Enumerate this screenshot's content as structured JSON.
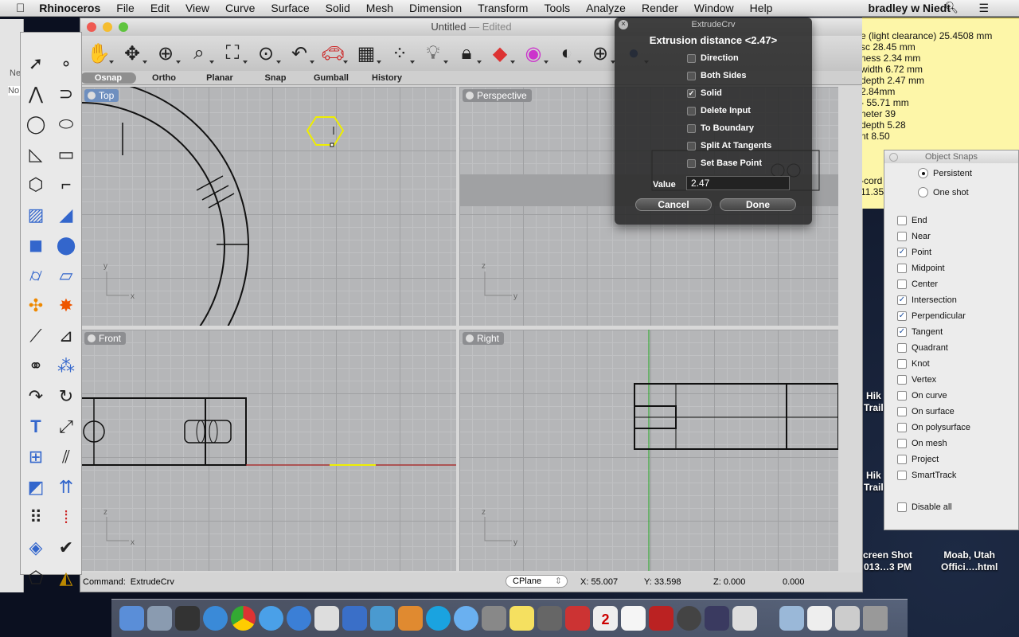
{
  "menubar": {
    "apple": "",
    "app": "Rhinoceros",
    "items": [
      "File",
      "Edit",
      "View",
      "Curve",
      "Surface",
      "Solid",
      "Mesh",
      "Dimension",
      "Transform",
      "Tools",
      "Analyze",
      "Render",
      "Window",
      "Help"
    ],
    "user": "bradley w Niedt"
  },
  "window": {
    "title": "Untitled",
    "edited": "— Edited"
  },
  "bgwin": {
    "label1": "Ne",
    "label2": "No"
  },
  "osnapbar": [
    "Osnap",
    "Ortho",
    "Planar",
    "Snap",
    "Gumball",
    "History"
  ],
  "viewports": {
    "top": "Top",
    "perspective": "Perspective",
    "front": "Front",
    "right": "Right"
  },
  "status": {
    "command_label": "Command:",
    "command": "ExtrudeCrv",
    "cplane": "CPlane",
    "x": "X: 55.007",
    "y": "Y: 33.598",
    "z": "Z: 0.000",
    "d": "0.000"
  },
  "hud": {
    "title": "ExtrudeCrv",
    "prompt": "Extrusion distance <2.47>",
    "options": [
      {
        "label": "Direction",
        "checked": false
      },
      {
        "label": "Both Sides",
        "checked": false
      },
      {
        "label": "Solid",
        "checked": true
      },
      {
        "label": "Delete Input",
        "checked": false
      },
      {
        "label": "To Boundary",
        "checked": false
      },
      {
        "label": "Split At Tangents",
        "checked": false
      },
      {
        "label": "Set Base Point",
        "checked": false
      }
    ],
    "value_label": "Value",
    "value": "2.47",
    "cancel": "Cancel",
    "done": "Done"
  },
  "sticky": [
    "e (light clearance) 25.4508 mm",
    "sc 28.45 mm",
    "ness 2.34 mm",
    "width 6.72 mm",
    "depth 2.47 mm",
    "2.84mm",
    "- 55.71 mm",
    "neter 39",
    "depth 5.28",
    "nt 8.50",
    "",
    "",
    "",
    "-cord",
    "11.35"
  ],
  "snaps": {
    "title": "Object Snaps",
    "persistent": "Persistent",
    "oneshot": "One shot",
    "mode": "Persistent",
    "items": [
      {
        "label": "End",
        "checked": false
      },
      {
        "label": "Near",
        "checked": false
      },
      {
        "label": "Point",
        "checked": true
      },
      {
        "label": "Midpoint",
        "checked": false
      },
      {
        "label": "Center",
        "checked": false
      },
      {
        "label": "Intersection",
        "checked": true
      },
      {
        "label": "Perpendicular",
        "checked": true
      },
      {
        "label": "Tangent",
        "checked": true
      },
      {
        "label": "Quadrant",
        "checked": false
      },
      {
        "label": "Knot",
        "checked": false
      },
      {
        "label": "Vertex",
        "checked": false
      },
      {
        "label": "On curve",
        "checked": false
      },
      {
        "label": "On surface",
        "checked": false
      },
      {
        "label": "On polysurface",
        "checked": false
      },
      {
        "label": "On mesh",
        "checked": false
      },
      {
        "label": "Project",
        "checked": false
      },
      {
        "label": "SmartTrack",
        "checked": false
      }
    ],
    "disable_all": "Disable all"
  },
  "desktop": {
    "items": [
      "Hik\nTrail",
      "Hik\nTrail",
      "creen Shot\n013…3 PM",
      "Moab, Utah\nOffici….html"
    ]
  },
  "dock": {
    "calendar_day": "2"
  }
}
